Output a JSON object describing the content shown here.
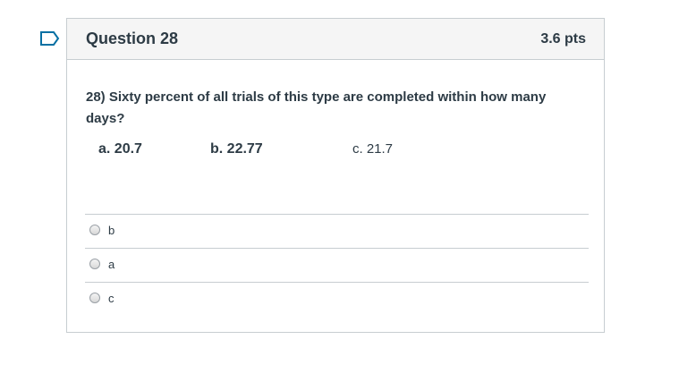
{
  "question": {
    "title": "Question 28",
    "points": "3.6 pts",
    "text": "28)   Sixty percent of all trials of this type are completed within how many days?",
    "choices": {
      "a": "a. 20.7",
      "b": "b. 22.77",
      "c": "c. 21.7"
    },
    "answers": [
      {
        "label": "b"
      },
      {
        "label": "a"
      },
      {
        "label": "c"
      }
    ]
  },
  "colors": {
    "flag": "#0770a3",
    "border": "#c7cdd1",
    "header_bg": "#f5f5f5",
    "text": "#2d3b45"
  },
  "icons": {
    "flag": "flag-icon"
  }
}
